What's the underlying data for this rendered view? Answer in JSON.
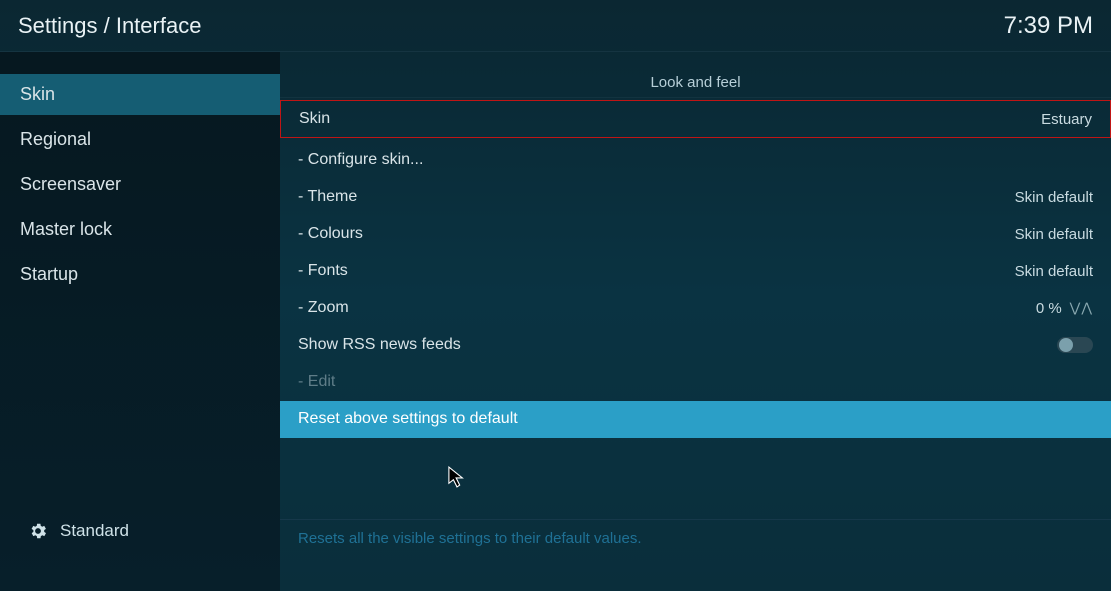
{
  "header": {
    "title": "Settings / Interface",
    "clock": "7:39 PM"
  },
  "sidebar": {
    "items": [
      {
        "label": "Skin"
      },
      {
        "label": "Regional"
      },
      {
        "label": "Screensaver"
      },
      {
        "label": "Master lock"
      },
      {
        "label": "Startup"
      }
    ],
    "level": "Standard"
  },
  "section": {
    "title": "Look and feel"
  },
  "rows": {
    "skin": {
      "label": "Skin",
      "value": "Estuary"
    },
    "configure": {
      "label": "- Configure skin..."
    },
    "theme": {
      "label": "- Theme",
      "value": "Skin default"
    },
    "colours": {
      "label": "- Colours",
      "value": "Skin default"
    },
    "fonts": {
      "label": "- Fonts",
      "value": "Skin default"
    },
    "zoom": {
      "label": "- Zoom",
      "value": "0 %"
    },
    "rss": {
      "label": "Show RSS news feeds"
    },
    "edit": {
      "label": "- Edit"
    },
    "reset": {
      "label": "Reset above settings to default"
    }
  },
  "description": "Resets all the visible settings to their default values."
}
